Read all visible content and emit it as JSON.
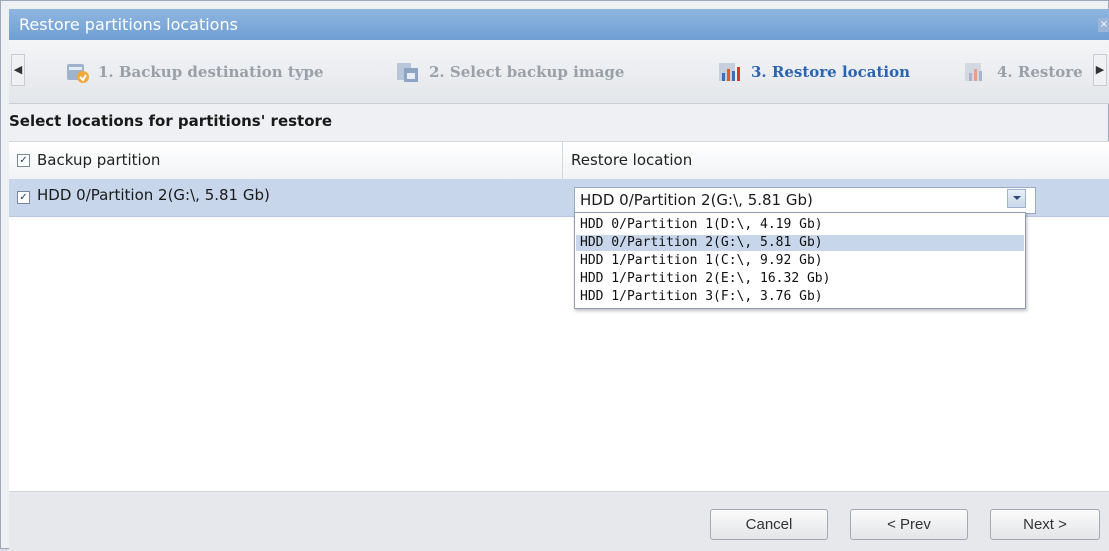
{
  "window": {
    "title": "Restore partitions locations"
  },
  "steps": [
    {
      "label": "1. Backup destination type",
      "state": "done"
    },
    {
      "label": "2. Select backup image",
      "state": "done"
    },
    {
      "label": "3. Restore location",
      "state": "active"
    },
    {
      "label": "4. Restore",
      "state": "pending"
    }
  ],
  "section": {
    "title": "Select locations for partitions' restore"
  },
  "grid": {
    "columns": [
      "Backup partition",
      "Restore location"
    ],
    "rows": [
      {
        "checked": true,
        "partition": "HDD 0/Partition 2(G:\\, 5.81 Gb)",
        "location": "HDD 0/Partition 2(G:\\, 5.81 Gb)"
      }
    ],
    "header_checked": true
  },
  "dropdown": {
    "options": [
      "HDD 0/Partition 1(D:\\, 4.19 Gb)",
      "HDD 0/Partition 2(G:\\, 5.81 Gb)",
      "HDD 1/Partition 1(C:\\, 9.92 Gb)",
      "HDD 1/Partition 2(E:\\, 16.32 Gb)",
      "HDD 1/Partition 3(F:\\, 3.76 Gb)"
    ],
    "selected": "HDD 0/Partition 2(G:\\, 5.81 Gb)"
  },
  "buttons": {
    "cancel": "Cancel",
    "prev": "< Prev",
    "next": "Next >"
  },
  "icons": {
    "close": "close-icon",
    "step": "wizard-step-icon",
    "check": "checkbox-check-icon"
  },
  "colors": {
    "titlebar": "#7ba6d8",
    "active_step": "#2b64b0",
    "selected_row": "#c7d6ea"
  }
}
